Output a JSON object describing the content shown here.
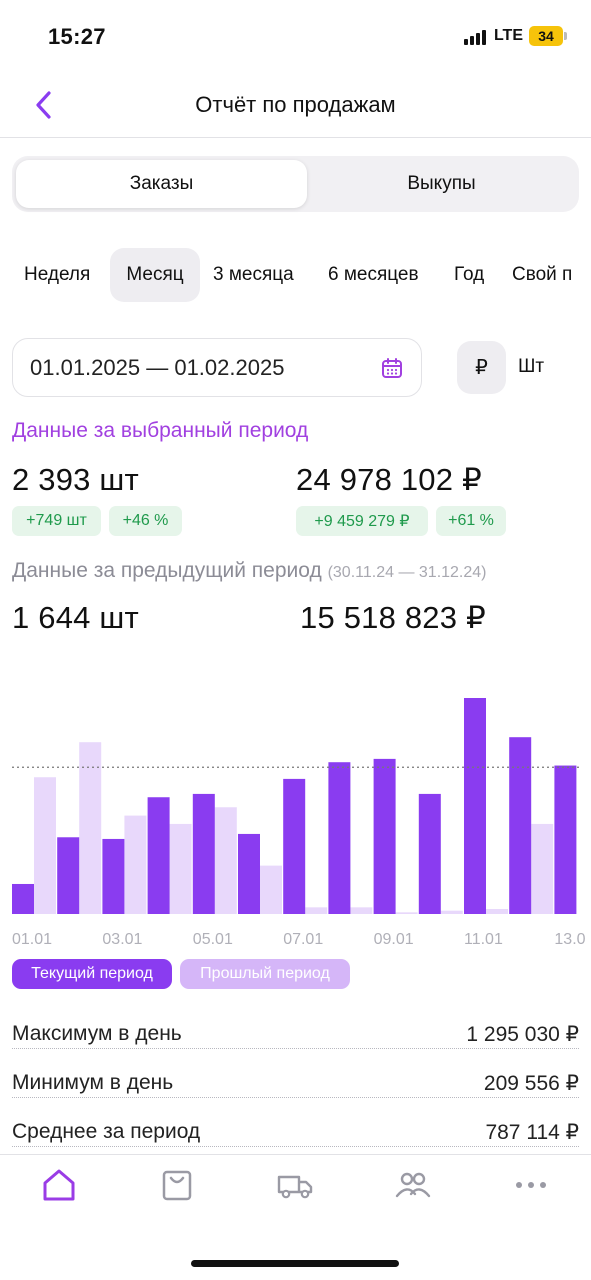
{
  "status": {
    "time": "15:27",
    "network": "LTE",
    "battery": "34"
  },
  "header": {
    "title": "Отчёт по продажам"
  },
  "segments": {
    "active": "Заказы",
    "inactive": "Выкупы"
  },
  "periods": [
    "Неделя",
    "Месяц",
    "3 месяца",
    "6 месяцев",
    "Год",
    "Свой п"
  ],
  "selected_period": "Месяц",
  "date_range": "01.01.2025 — 01.02.2025",
  "units": {
    "currency": "₽",
    "pieces": "Шт"
  },
  "current": {
    "title": "Данные за выбранный период",
    "qty": "2 393 шт",
    "qty_delta": "+749 шт",
    "qty_pct": "+46 %",
    "sum": "24 978 102 ₽",
    "sum_delta": "+9 459 279 ₽",
    "sum_pct": "+61 %"
  },
  "previous": {
    "title": "Данные за предыдущий период",
    "range": "(30.11.24 — 31.12.24)",
    "qty": "1 644 шт",
    "sum": "15 518 823 ₽"
  },
  "chart_data": {
    "type": "bar",
    "categories": [
      "01.01",
      "02.01",
      "03.01",
      "04.01",
      "05.01",
      "06.01",
      "07.01",
      "08.01",
      "09.01",
      "10.01",
      "11.01",
      "12.01",
      "13.01"
    ],
    "x_tick_labels": [
      "01.01",
      "03.01",
      "05.01",
      "07.01",
      "09.01",
      "11.01",
      "13.0"
    ],
    "series": [
      {
        "name": "Текущий период",
        "color": "#8a3cf0",
        "values": [
          180,
          460,
          450,
          700,
          720,
          480,
          810,
          910,
          930,
          720,
          1295,
          1060,
          890
        ]
      },
      {
        "name": "Прошлый период",
        "color": "#e8d8fb",
        "values": [
          820,
          1030,
          590,
          540,
          640,
          290,
          40,
          40,
          10,
          20,
          30,
          540,
          0
        ]
      }
    ],
    "reference_line": 880,
    "legend": "bottom"
  },
  "stats": [
    {
      "label": "Максимум в день",
      "value": "1 295 030 ₽"
    },
    {
      "label": "Минимум в день",
      "value": "209 556 ₽"
    },
    {
      "label": "Среднее за период",
      "value": "787 114 ₽"
    }
  ],
  "icons": {
    "back": "chevron-left-icon",
    "calendar": "calendar-icon",
    "tabs": [
      "home-icon",
      "bag-icon",
      "truck-icon",
      "users-icon",
      "more-icon"
    ]
  },
  "colors": {
    "accent": "#a140e0",
    "bar_current": "#8a3cf0",
    "bar_previous": "#e8d8fb",
    "positive": "#1f9a4c",
    "positive_bg": "#e6f5ea"
  }
}
